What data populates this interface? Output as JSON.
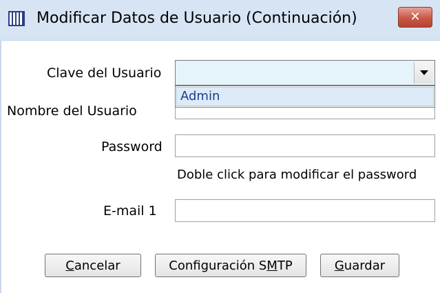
{
  "window": {
    "title": "Modificar Datos de Usuario (Continuación)",
    "icon": "window-app-icon",
    "close_icon": "close-icon",
    "close_label": "✕"
  },
  "form": {
    "clave_label": "Clave del Usuario",
    "clave_value": "",
    "clave_dropdown_options": [
      "Admin"
    ],
    "nombre_label": "Nombre del Usuario",
    "nombre_value": "",
    "password_label": "Password",
    "password_value": "",
    "password_hint": "Doble click para modificar el password",
    "email_label": "E-mail 1",
    "email_value": ""
  },
  "buttons": {
    "cancelar": {
      "mnemonic": "C",
      "rest": "ancelar"
    },
    "smtp": {
      "before": "Configuración S",
      "mnemonic": "M",
      "rest": "TP"
    },
    "guardar": {
      "mnemonic": "G",
      "rest": "uardar"
    }
  },
  "colors": {
    "titlebar_bg": "#d6e4f4",
    "close_button": "#c75844",
    "combo_focus_bg": "#e5f3fb",
    "dropdown_item_text": "#1b3c8e"
  }
}
